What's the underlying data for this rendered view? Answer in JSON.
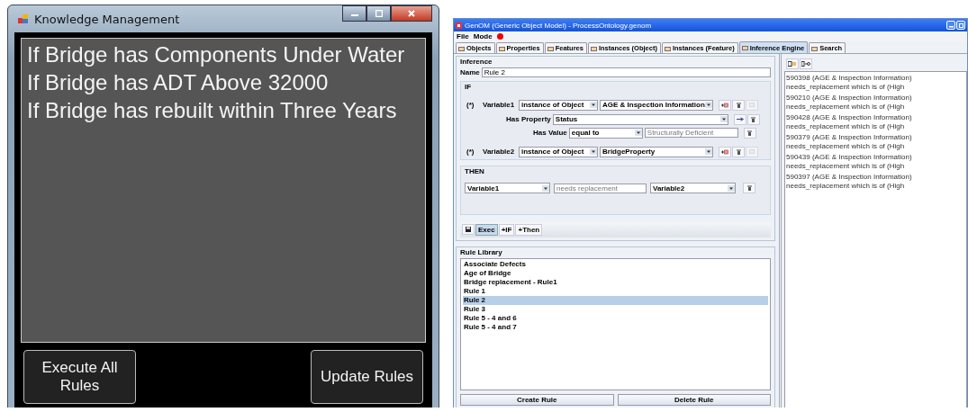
{
  "knowledge_window": {
    "title": "Knowledge Management",
    "rules": [
      "If Bridge has Components Under Water",
      "If Bridge has ADT Above 32000",
      "If Bridge has rebuilt within Three Years"
    ],
    "buttons": [
      "Execute All Rules",
      "Update Rules"
    ]
  },
  "genom_window": {
    "title": "GenOM (Generic Object Model) - ProcessOntology.genom",
    "menu": [
      "File",
      "Mode"
    ],
    "tabs": [
      {
        "label": "Objects",
        "selected": false
      },
      {
        "label": "Properties",
        "selected": false
      },
      {
        "label": "Features",
        "selected": false
      },
      {
        "label": "Instances (Object)",
        "selected": false
      },
      {
        "label": "Instances (Feature)",
        "selected": false
      },
      {
        "label": "Inference Engine",
        "selected": true
      },
      {
        "label": "Search",
        "selected": false
      }
    ],
    "inference": {
      "group_label": "Inference",
      "name_label": "Name",
      "name_value": "Rule 2",
      "if_label": "IF",
      "variables": [
        {
          "marker": "(*)",
          "name": "Variable1",
          "type": "instance of Object",
          "class": "AGE & Inspection Information",
          "conditions": [
            {
              "property_label": "Has Property",
              "property": "Status",
              "value_label": "Has Value",
              "operator": "equal to",
              "value": "Structurally Deficient"
            }
          ]
        },
        {
          "marker": "(*)",
          "name": "Variable2",
          "type": "instance of Object",
          "class": "BridgeProperty"
        }
      ],
      "then_label": "THEN",
      "then": {
        "subject": "Variable1",
        "relation": "needs replacement",
        "object": "Variable2"
      },
      "toolbar": [
        {
          "label": "Exec",
          "selected": true
        },
        {
          "label": "+IF",
          "selected": false
        },
        {
          "label": "+Then",
          "selected": false
        }
      ]
    },
    "rule_library": {
      "label": "Rule Library",
      "rules": [
        {
          "label": "Associate Defects",
          "selected": false
        },
        {
          "label": "Age of Bridge",
          "selected": false
        },
        {
          "label": "Bridge replacement - Rule1",
          "selected": false
        },
        {
          "label": "Rule 1",
          "selected": false
        },
        {
          "label": "Rule 2",
          "selected": true
        },
        {
          "label": "Rule 3",
          "selected": false
        },
        {
          "label": "Rule 5 - 4 and 6",
          "selected": false
        },
        {
          "label": "Rule 5 - 4 and 7",
          "selected": false
        }
      ],
      "buttons": [
        "Create Rule",
        "Delete Rule"
      ]
    },
    "results": [
      "590398 (AGE & Inspection Information) needs_replacement which is of (High",
      "590210 (AGE & Inspection Information) needs_replacement which is of (High",
      "590428 (AGE & Inspection Information) needs_replacement which is of (High",
      "590379 (AGE & Inspection Information) needs_replacement which is of (High",
      "590439 (AGE & Inspection Information) needs_replacement which is of (High",
      "590397 (AGE & Inspection Information) needs_replacement which is of (High"
    ]
  }
}
